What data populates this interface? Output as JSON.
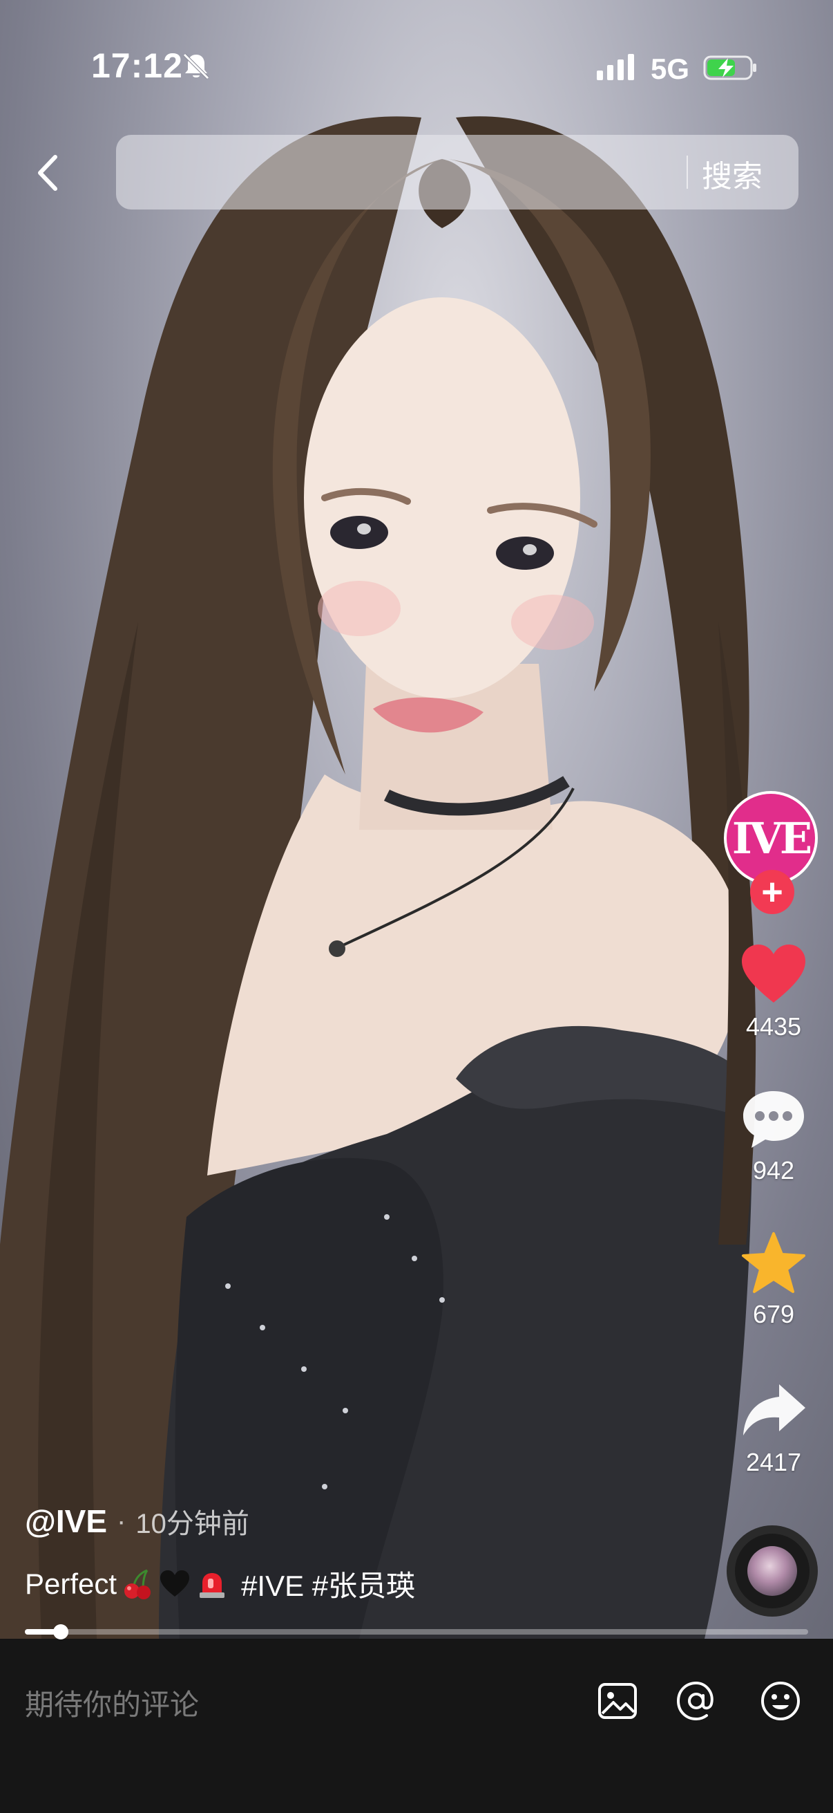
{
  "status_bar": {
    "time": "17:12",
    "network": "5G"
  },
  "search": {
    "placeholder": "",
    "button_label": "搜索"
  },
  "side_rail": {
    "avatar_text": "IVE",
    "follow_symbol": "+",
    "like_count": "4435",
    "comment_count": "942",
    "favorite_count": "679",
    "share_count": "2417"
  },
  "post": {
    "author": "@IVE",
    "separator": "·",
    "time_ago": "10分钟前",
    "caption_text": "Perfect",
    "hashtags": "#IVE #张员瑛"
  },
  "playback": {
    "progress_fraction": 0.046
  },
  "comment_bar": {
    "placeholder": "期待你的评论"
  },
  "icons": {
    "back": "chevron-left-icon",
    "bell_off": "bell-off-icon",
    "signal": "signal-icon",
    "battery": "battery-charging-icon",
    "like": "heart-icon",
    "comment": "chat-bubble-icon",
    "favorite": "star-icon",
    "share": "share-arrow-icon",
    "image": "image-icon",
    "mention": "at-icon",
    "emoji": "emoji-icon"
  },
  "colors": {
    "like": "#f0374f",
    "favorite": "#f9b52c",
    "avatar_bg": "#e12d8b",
    "follow": "#f23a53"
  }
}
